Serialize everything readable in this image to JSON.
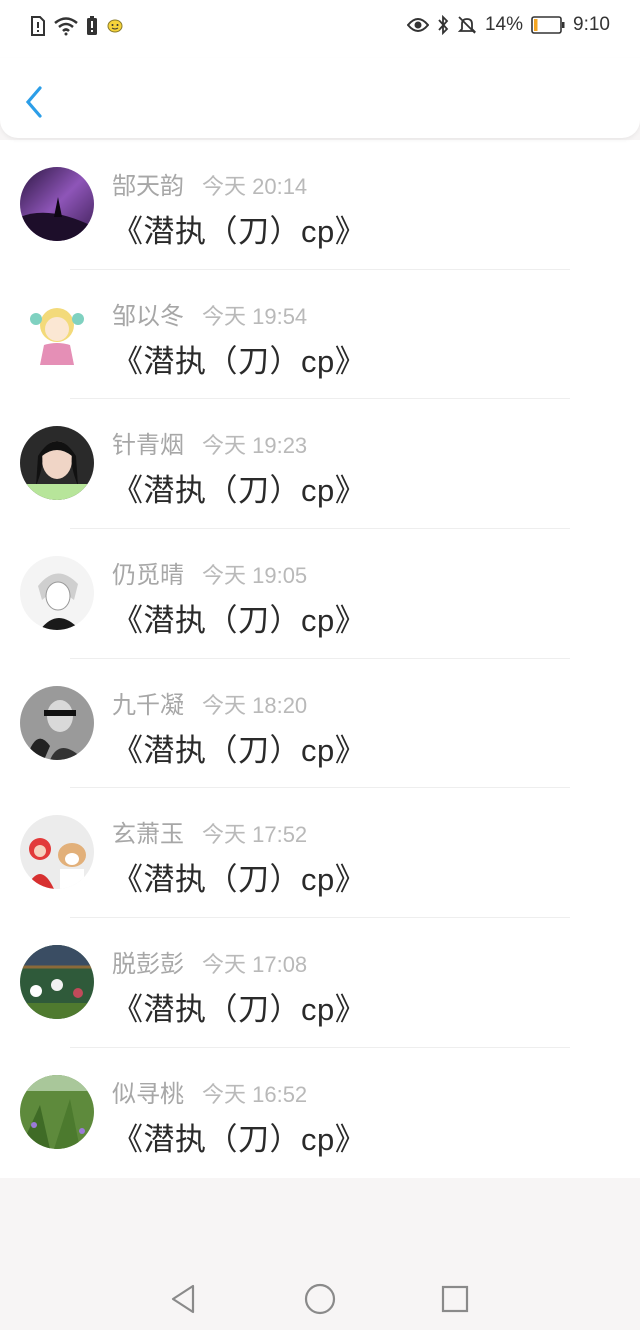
{
  "status_bar": {
    "battery_percent": "14%",
    "time": "9:10",
    "left_icons": [
      "sim-alert-icon",
      "wifi-icon",
      "battery-alert-icon",
      "app-notification-icon"
    ],
    "right_icons": [
      "eye-icon",
      "bluetooth-icon",
      "mute-bell-icon",
      "battery-icon"
    ],
    "battery_level": 0.14,
    "battery_color": "#f5a623"
  },
  "header": {
    "back_icon": "chevron-left-icon",
    "accent_color": "#2c9ee8"
  },
  "items": [
    {
      "name": "郜天韵",
      "time": "今天 20:14",
      "content": "《潜执（刀）cp》"
    },
    {
      "name": "邹以冬",
      "time": "今天 19:54",
      "content": "《潜执（刀）cp》"
    },
    {
      "name": "针青烟",
      "time": "今天 19:23",
      "content": "《潜执（刀）cp》"
    },
    {
      "name": "仍觅晴",
      "time": "今天 19:05",
      "content": "《潜执（刀）cp》"
    },
    {
      "name": "九千凝",
      "time": "今天 18:20",
      "content": "《潜执（刀）cp》"
    },
    {
      "name": "玄萧玉",
      "time": "今天 17:52",
      "content": "《潜执（刀）cp》"
    },
    {
      "name": "脱彭彭",
      "time": "今天 17:08",
      "content": "《潜执（刀）cp》"
    },
    {
      "name": "似寻桃",
      "time": "今天 16:52",
      "content": "《潜执（刀）cp》"
    }
  ],
  "nav": {
    "icons": [
      "back-triangle-icon",
      "home-circle-icon",
      "recents-square-icon"
    ]
  }
}
